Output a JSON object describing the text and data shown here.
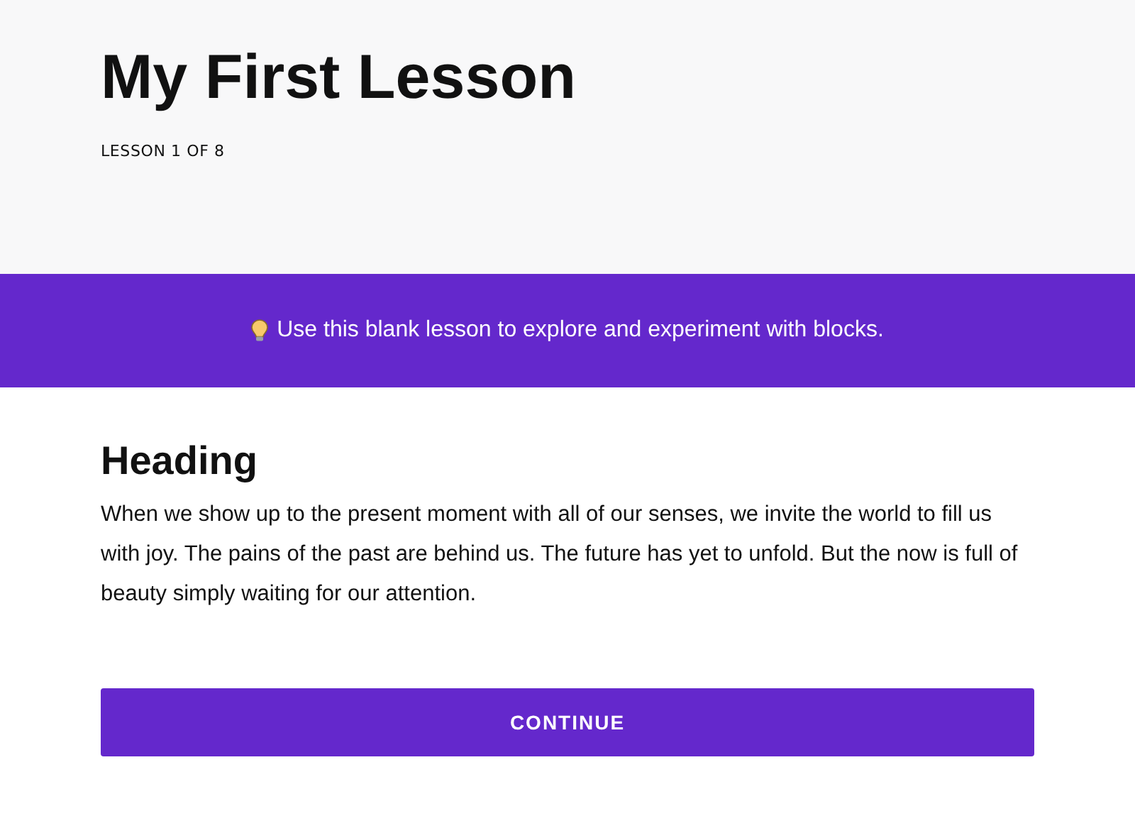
{
  "header": {
    "title": "My First Lesson",
    "progress": "LESSON 1 OF 8"
  },
  "banner": {
    "text": "Use this blank lesson to explore and experiment with blocks."
  },
  "content": {
    "heading": "Heading",
    "paragraph": "When we show up to the present moment with all of our senses, we invite the world to fill us with joy. The pains of the past are behind us. The future has yet to unfold. But the now is full of beauty simply waiting for our attention."
  },
  "buttons": [
    "CONTINUE"
  ]
}
